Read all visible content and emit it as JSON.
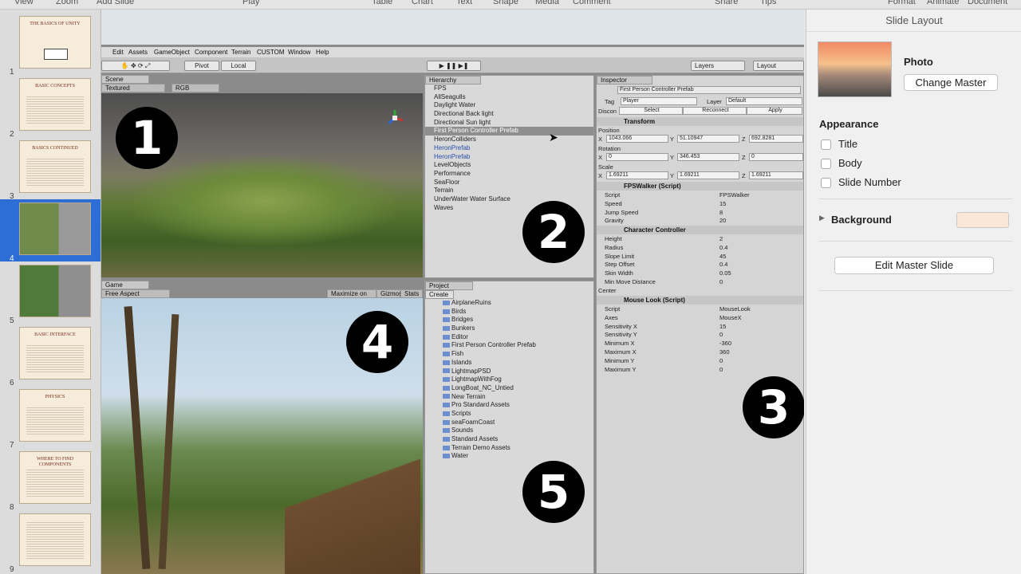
{
  "toolbar": {
    "view": "View",
    "zoom": "Zoom",
    "add_slide": "Add Slide",
    "play": "Play",
    "table": "Table",
    "chart": "Chart",
    "text": "Text",
    "shape": "Shape",
    "media": "Media",
    "comment": "Comment",
    "share": "Share",
    "tips": "Tips",
    "format": "Format",
    "animate": "Animate",
    "document": "Document"
  },
  "slides": [
    {
      "num": "1",
      "title": "THE BASICS OF UNITY"
    },
    {
      "num": "2",
      "title": "BASIC CONCEPTS"
    },
    {
      "num": "3",
      "title": "BASICS CONTINUED"
    },
    {
      "num": "4",
      "title": ""
    },
    {
      "num": "5",
      "title": ""
    },
    {
      "num": "6",
      "title": "BASIC INTERFACE"
    },
    {
      "num": "7",
      "title": "PHYSICS"
    },
    {
      "num": "8",
      "title": "WHERE TO FIND COMPONENTS"
    },
    {
      "num": "9",
      "title": ""
    }
  ],
  "unity": {
    "menu": [
      "Edit",
      "Assets",
      "GameObject",
      "Component",
      "Terrain",
      "CUSTOM",
      "Window",
      "Help"
    ],
    "pivot": "Pivot",
    "local": "Local",
    "layers": "Layers",
    "layout": "Layout",
    "scene_tab": "Scene",
    "scene_mode": "Textured",
    "scene_rgb": "RGB",
    "game_tab": "Game",
    "game_aspect": "Free Aspect",
    "maximize": "Maximize on Play",
    "gizmos": "Gizmos",
    "stats": "Stats",
    "hierarchy_tab": "Hierarchy",
    "hierarchy_items": [
      "FPS",
      "AllSeagulls",
      "Daylight Water",
      "Directional Back light",
      "Directional Sun light",
      "First Person Controller Prefab",
      "HeronColliders",
      "HeronPrefab",
      "HeronPrefab",
      "LevelObjects",
      "Performance",
      "SeaFloor",
      "Terrain",
      "UnderWater Water Surface",
      "Waves"
    ],
    "project_tab": "Project",
    "create": "Create",
    "project_items": [
      "AirplaneRuins",
      "Birds",
      "Bridges",
      "Bunkers",
      "Editor",
      "First Person Controller Prefab",
      "Fish",
      "Islands",
      "LightmapPSD",
      "LightmapWithFog",
      "LongBoat_NC_Untied",
      "New Terrain",
      "Pro Standard Assets",
      "Scripts",
      "seaFoamCoast",
      "Sounds",
      "Standard Assets",
      "Terrain Demo Assets",
      "Water"
    ],
    "inspector": {
      "tab": "Inspector",
      "object_name": "First Person Controller Prefab",
      "tag_label": "Tag",
      "tag": "Player",
      "layer_label": "Layer",
      "layer": "Default",
      "disconnect": "Discon",
      "select": "Select",
      "reconnect": "Reconnect",
      "apply": "Apply",
      "transform": "Transform",
      "position": "Position",
      "pos_x": "1043.066",
      "pos_y": "51.10947",
      "pos_z": "692.8281",
      "rotation": "Rotation",
      "rot_x": "0",
      "rot_y": "346.453",
      "rot_z": "0",
      "scale": "Scale",
      "scale_x": "1.69211",
      "scale_y": "1.69211",
      "scale_z": "1.69211",
      "fps_walker": "FPSWalker (Script)",
      "fps_rows": [
        [
          "Script",
          "FPSWalker"
        ],
        [
          "Speed",
          "15"
        ],
        [
          "Jump Speed",
          "8"
        ],
        [
          "Gravity",
          "20"
        ]
      ],
      "char_controller": "Character Controller",
      "cc_rows": [
        [
          "Height",
          "2"
        ],
        [
          "Radius",
          "0.4"
        ],
        [
          "Slope Limit",
          "45"
        ],
        [
          "Step Offset",
          "0.4"
        ],
        [
          "Skin Width",
          "0.05"
        ],
        [
          "Min Move Distance",
          "0"
        ]
      ],
      "center": "Center",
      "mouse_look": "Mouse Look (Script)",
      "ml_rows": [
        [
          "Script",
          "MouseLook"
        ],
        [
          "Axes",
          "MouseX"
        ],
        [
          "Sensitivity X",
          "15"
        ],
        [
          "Sensitivity Y",
          "0"
        ],
        [
          "Minimum X",
          "-360"
        ],
        [
          "Maximum X",
          "360"
        ],
        [
          "Minimum Y",
          "0"
        ],
        [
          "Maximum Y",
          "0"
        ]
      ],
      "axis_x": "X",
      "axis_y": "Y",
      "axis_z": "Z"
    }
  },
  "badges": [
    "1",
    "2",
    "3",
    "4",
    "5"
  ],
  "slide_layout": {
    "header": "Slide Layout",
    "master_name": "Photo",
    "change_master": "Change Master",
    "appearance": "Appearance",
    "options": [
      "Title",
      "Body",
      "Slide Number"
    ],
    "background": "Background",
    "background_color": "#fbe7d8",
    "edit_master": "Edit Master Slide"
  }
}
